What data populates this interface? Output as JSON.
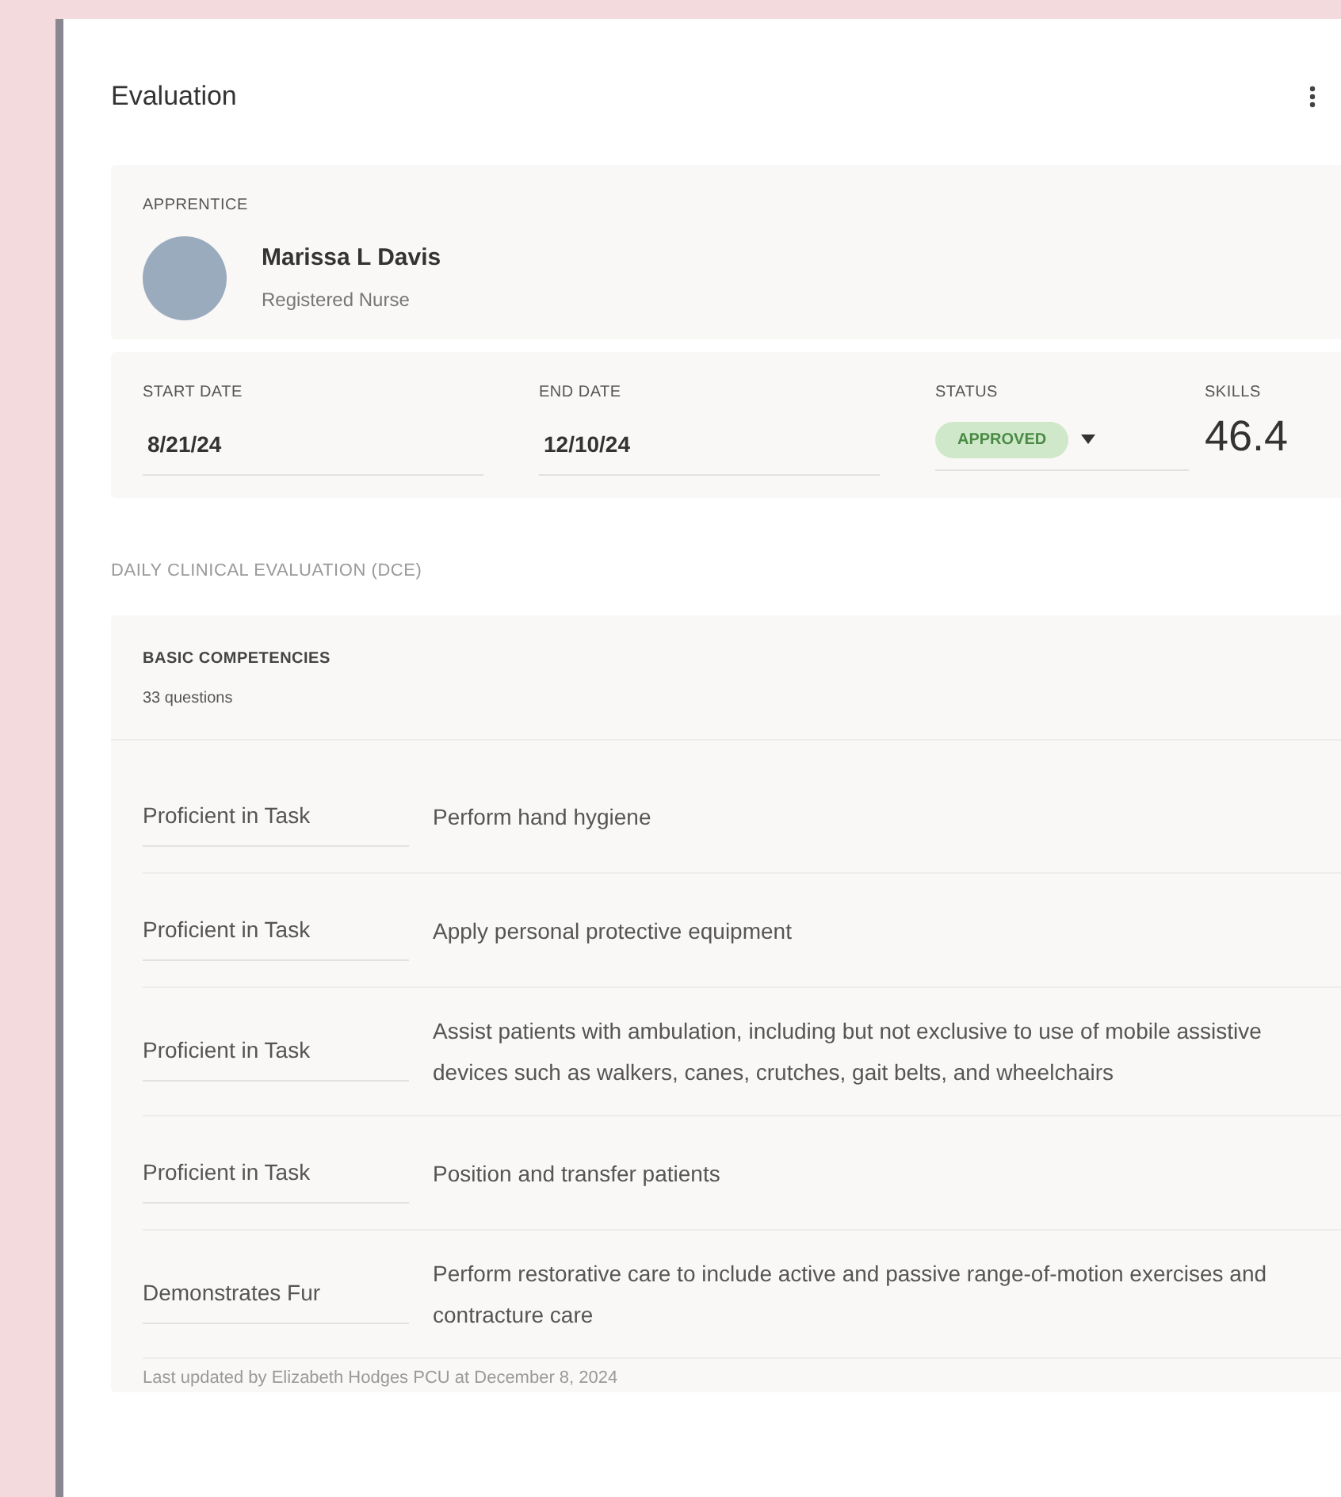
{
  "header": {
    "title": "Evaluation"
  },
  "apprentice": {
    "label": "APPRENTICE",
    "name": "Marissa L Davis",
    "role": "Registered Nurse"
  },
  "fields": [
    {
      "kind": "text",
      "label": "START DATE",
      "value": "8/21/24"
    },
    {
      "kind": "text",
      "label": "END DATE",
      "value": "12/10/24"
    },
    {
      "kind": "status",
      "label": "STATUS",
      "value": "APPROVED"
    },
    {
      "kind": "score",
      "label": "SKILLS",
      "value": "46.4"
    }
  ],
  "section": {
    "title": "DAILY CLINICAL EVALUATION (DCE)"
  },
  "group": {
    "title": "BASIC COMPETENCIES",
    "count": "33 questions"
  },
  "rows": [
    {
      "rating": "Proficient in Task",
      "task": "Perform hand hygiene"
    },
    {
      "rating": "Proficient in Task",
      "task": "Apply personal protective equipment"
    },
    {
      "rating": "Proficient in Task",
      "task": "Assist patients with ambulation, including but not exclusive to use of mobile assistive devices such as walkers, canes, crutches, gait belts, and wheelchairs"
    },
    {
      "rating": "Proficient in Task",
      "task": "Position and transfer patients"
    },
    {
      "rating": "Demonstrates Fur",
      "task": "Perform restorative care to include active and passive range-of-motion exercises and contracture care"
    }
  ],
  "footer": {
    "text": "Last updated by Elizabeth Hodges PCU at December 8, 2024"
  }
}
